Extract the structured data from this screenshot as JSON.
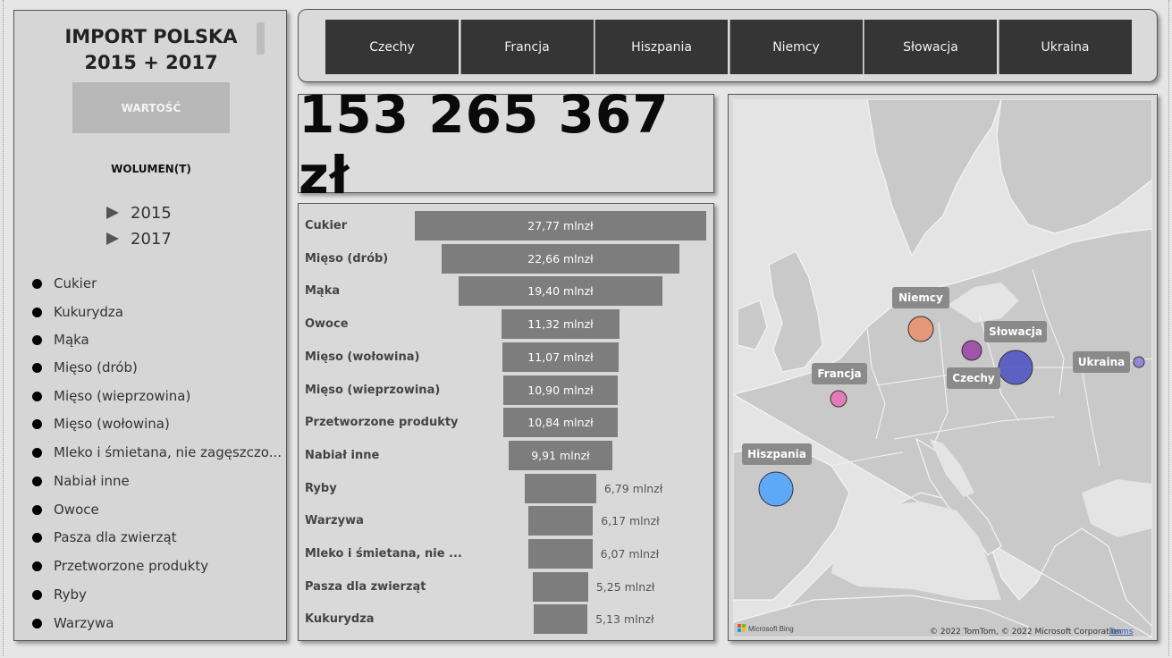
{
  "sidebar": {
    "title_line1": "IMPORT POLSKA",
    "title_line2": "2015 + 2017",
    "wartosc_label": "WARTOŚĆ",
    "wolumen_label": "WOLUMEN(T)",
    "years": [
      "2015",
      "2017"
    ],
    "categories": [
      "Cukier",
      "Kukurydza",
      "Mąka",
      "Mięso (drób)",
      "Mięso (wieprzowina)",
      "Mięso (wołowina)",
      "Mleko i śmietana, nie zagęszczo...",
      "Nabiał inne",
      "Owoce",
      "Pasza dla zwierząt",
      "Przetworzone produkty",
      "Ryby",
      "Warzywa"
    ]
  },
  "tabs": [
    "Czechy",
    "Francja",
    "Hiszpania",
    "Niemcy",
    "Słowacja",
    "Ukraina"
  ],
  "kpi": {
    "value": "153 265 367 zł"
  },
  "chart_data": {
    "type": "bar",
    "orientation": "funnel",
    "categories": [
      "Cukier",
      "Mięso (drób)",
      "Mąka",
      "Owoce",
      "Mięso (wołowina)",
      "Mięso (wieprzowina)",
      "Przetworzone produkty",
      "Nabiał inne",
      "Ryby",
      "Warzywa",
      "Mleko i śmietana, nie ...",
      "Pasza dla zwierząt",
      "Kukurydza"
    ],
    "values": [
      27.77,
      22.66,
      19.4,
      11.32,
      11.07,
      10.9,
      10.84,
      9.91,
      6.79,
      6.17,
      6.07,
      5.25,
      5.13
    ],
    "labels": [
      "27,77 mlnzł",
      "22,66 mlnzł",
      "19,40 mlnzł",
      "11,32 mlnzł",
      "11,07 mlnzł",
      "10,90 mlnzł",
      "10,84 mlnzł",
      "9,91 mlnzł",
      "6,79 mlnzł",
      "6,17 mlnzł",
      "6,07 mlnzł",
      "5,25 mlnzł",
      "5,13 mlnzł"
    ],
    "unit": "mlnzł"
  },
  "map": {
    "points": [
      {
        "name": "Niemcy",
        "color": "#e8916b"
      },
      {
        "name": "Słowacja",
        "color": "#4a4fc2"
      },
      {
        "name": "Czechy",
        "color": "#9a3fa5"
      },
      {
        "name": "Ukraina",
        "color": "#8c7ad8"
      },
      {
        "name": "Francja",
        "color": "#e56eb5"
      },
      {
        "name": "Hiszpania",
        "color": "#4aa3ff"
      }
    ],
    "brand": "Microsoft Bing",
    "attribution": "© 2022 TomTom, © 2022 Microsoft Corporation",
    "terms_label": "Terms"
  },
  "colors": {
    "tab_bg": "#353535",
    "bar": "#7d7d7d",
    "panel_bg": "#d9d9d9"
  }
}
